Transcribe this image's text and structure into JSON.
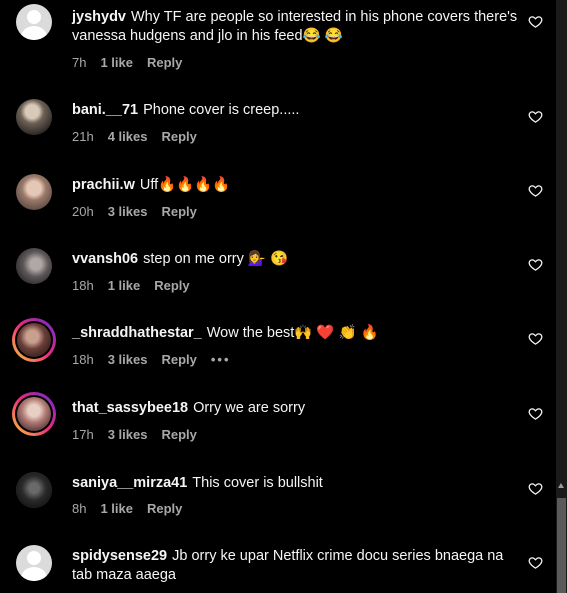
{
  "comments": [
    {
      "username": "jyshydv",
      "text": "Why TF are people so interested in his phone covers there's vanessa hudgens and jlo in his feed😂 😂",
      "time": "7h",
      "likes": "1 like",
      "reply": "Reply",
      "avatar": "default"
    },
    {
      "username": "bani.__71",
      "text": "Phone cover is creep.....",
      "time": "21h",
      "likes": "4 likes",
      "reply": "Reply",
      "avatar": "photo"
    },
    {
      "username": "prachii.w",
      "text": "Uff🔥🔥🔥🔥",
      "time": "20h",
      "likes": "3 likes",
      "reply": "Reply",
      "avatar": "photo"
    },
    {
      "username": "vvansh06",
      "text": "step on me orry 💁‍♀️ 😘",
      "time": "18h",
      "likes": "1 like",
      "reply": "Reply",
      "avatar": "photo"
    },
    {
      "username": "_shraddhathestar_",
      "text": "Wow the best🙌 ❤️ 👏 🔥",
      "time": "18h",
      "likes": "3 likes",
      "reply": "Reply",
      "more": "•••",
      "avatar": "ring"
    },
    {
      "username": "that_sassybee18",
      "text": "Orry we are sorry",
      "time": "17h",
      "likes": "3 likes",
      "reply": "Reply",
      "avatar": "ring"
    },
    {
      "username": "saniya__mirza41",
      "text": "This cover is bullshit",
      "time": "8h",
      "likes": "1 like",
      "reply": "Reply",
      "avatar": "photo"
    },
    {
      "username": "spidysense29",
      "text": "Jb orry ke upar Netflix crime docu series bnaega na tab maza aaega",
      "time": "",
      "likes": "",
      "reply": "",
      "avatar": "default"
    }
  ],
  "icons": {
    "like": "heart-outline-icon",
    "more": "more-options-icon"
  },
  "colors": {
    "background": "#000000",
    "text": "#f5f5f5",
    "secondary": "#a8a8a8"
  }
}
